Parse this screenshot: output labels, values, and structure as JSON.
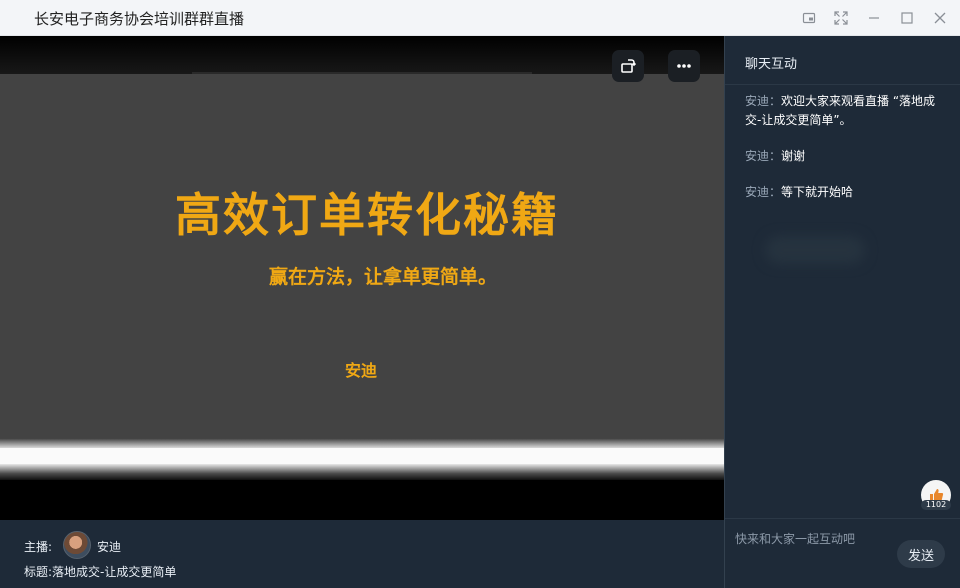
{
  "window": {
    "title": "长安电子商务协会培训群群直播"
  },
  "video": {
    "slide_title": "高效订单转化秘籍",
    "slide_subtitle": "赢在方法，让拿单更简单。",
    "slide_author": "安迪",
    "accent_color": "#f0a814",
    "buttons": {
      "rotate_icon": "rotate-screen-icon",
      "more_icon": "more-dots-icon"
    }
  },
  "stream_info": {
    "host_label": "主播:",
    "host_name": "安迪",
    "topic_label": "标题:",
    "topic": "落地成交-让成交更简单"
  },
  "chat": {
    "title": "聊天互动",
    "messages": [
      {
        "sender": "安迪：",
        "text": "欢迎大家来观看直播 “落地成交-让成交更简单”。"
      },
      {
        "sender": "安迪：",
        "text": "谢谢"
      },
      {
        "sender": "安迪：",
        "text": "等下就开始哈"
      }
    ],
    "like_count": "1102",
    "input_placeholder": "快来和大家一起互动吧",
    "send_label": "发送"
  }
}
